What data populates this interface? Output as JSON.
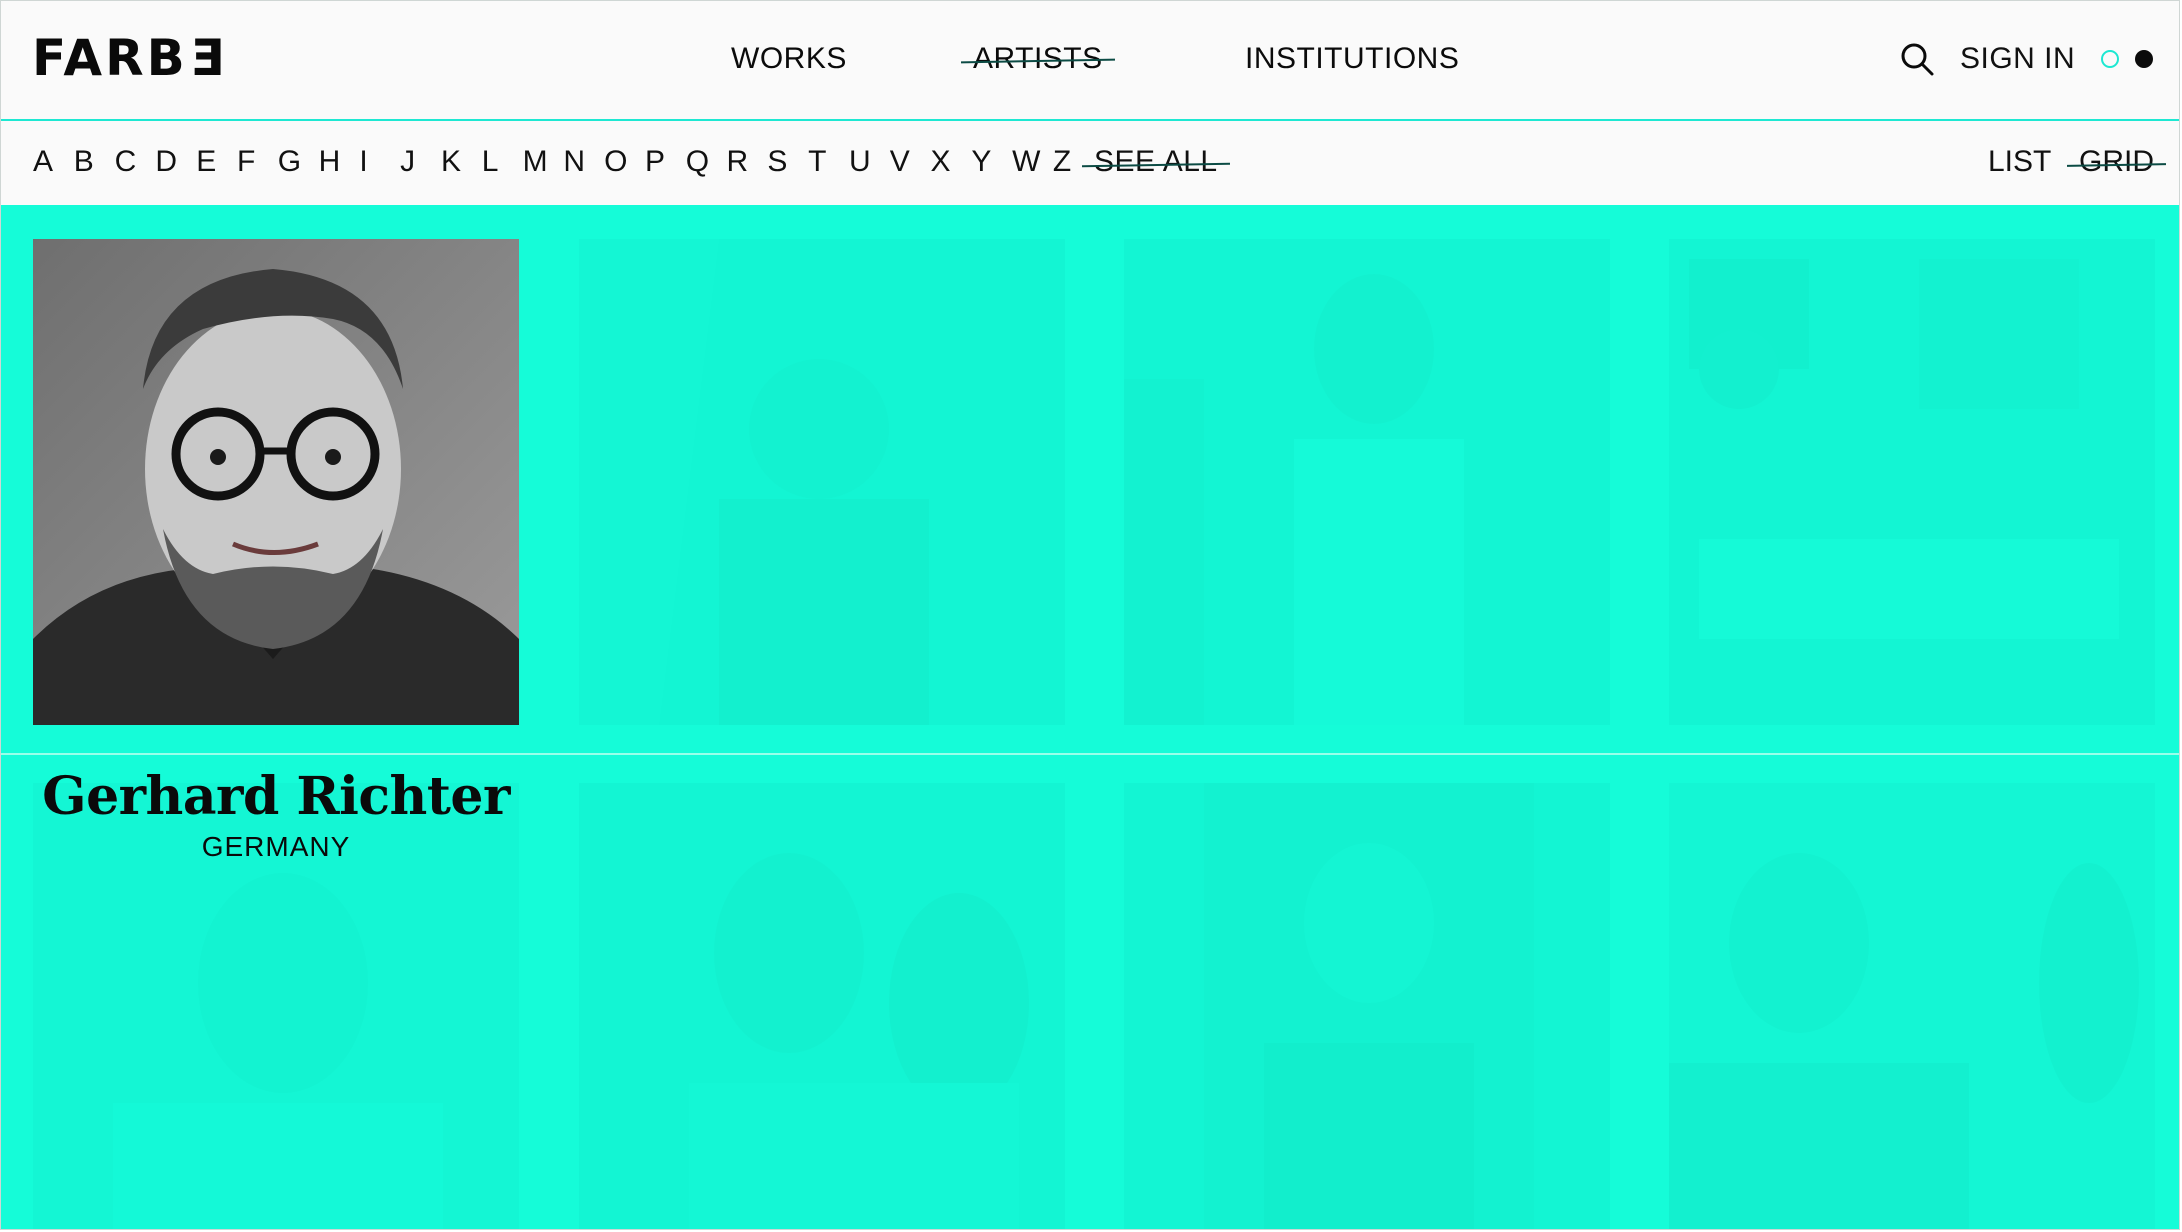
{
  "header": {
    "logo": {
      "prefix": "FARB",
      "reversed_char": "E"
    },
    "nav": [
      {
        "label": "WORKS",
        "active": false
      },
      {
        "label": "ARTISTS",
        "active": true
      },
      {
        "label": "INSTITUTIONS",
        "active": false
      }
    ],
    "search_icon": "search-icon",
    "sign_in_label": "SIGN IN",
    "theme_toggle": {
      "options": [
        "light",
        "dark"
      ],
      "selected": "dark"
    }
  },
  "filter": {
    "letters": [
      "A",
      "B",
      "C",
      "D",
      "E",
      "F",
      "G",
      "H",
      "I",
      "J",
      "K",
      "L",
      "M",
      "N",
      "O",
      "P",
      "Q",
      "R",
      "S",
      "T",
      "U",
      "V",
      "X",
      "Y",
      "W",
      "Z"
    ],
    "see_all_label": "SEE ALL",
    "views": [
      {
        "label": "LIST",
        "active": false
      },
      {
        "label": "GRID",
        "active": true
      }
    ]
  },
  "featured": {
    "name": "Gerhard Richter",
    "country": "GERMANY"
  },
  "colors": {
    "accent": "#15fcd8",
    "text": "#0a0a0a",
    "background": "#fafafa"
  }
}
